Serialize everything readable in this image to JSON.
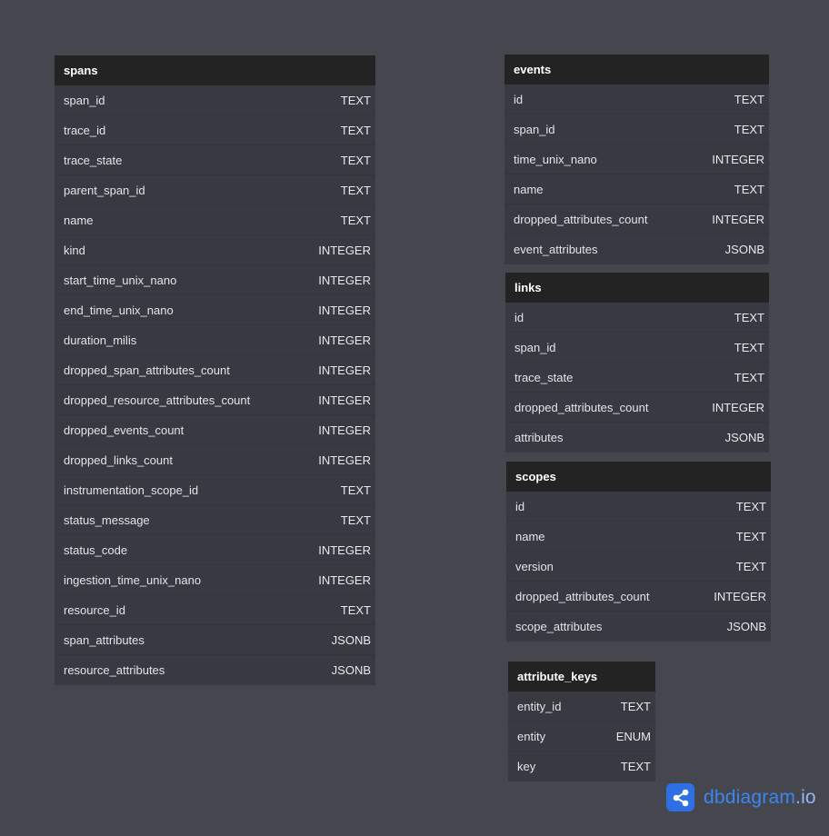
{
  "tables": [
    {
      "id": "spans",
      "name": "spans",
      "columns": [
        {
          "name": "span_id",
          "type": "TEXT"
        },
        {
          "name": "trace_id",
          "type": "TEXT"
        },
        {
          "name": "trace_state",
          "type": "TEXT"
        },
        {
          "name": "parent_span_id",
          "type": "TEXT"
        },
        {
          "name": "name",
          "type": "TEXT"
        },
        {
          "name": "kind",
          "type": "INTEGER"
        },
        {
          "name": "start_time_unix_nano",
          "type": "INTEGER"
        },
        {
          "name": "end_time_unix_nano",
          "type": "INTEGER"
        },
        {
          "name": "duration_milis",
          "type": "INTEGER"
        },
        {
          "name": "dropped_span_attributes_count",
          "type": "INTEGER"
        },
        {
          "name": "dropped_resource_attributes_count",
          "type": "INTEGER"
        },
        {
          "name": "dropped_events_count",
          "type": "INTEGER"
        },
        {
          "name": "dropped_links_count",
          "type": "INTEGER"
        },
        {
          "name": "instrumentation_scope_id",
          "type": "TEXT"
        },
        {
          "name": "status_message",
          "type": "TEXT"
        },
        {
          "name": "status_code",
          "type": "INTEGER"
        },
        {
          "name": "ingestion_time_unix_nano",
          "type": "INTEGER"
        },
        {
          "name": "resource_id",
          "type": "TEXT"
        },
        {
          "name": "span_attributes",
          "type": "JSONB"
        },
        {
          "name": "resource_attributes",
          "type": "JSONB"
        }
      ]
    },
    {
      "id": "events",
      "name": "events",
      "columns": [
        {
          "name": "id",
          "type": "TEXT"
        },
        {
          "name": "span_id",
          "type": "TEXT"
        },
        {
          "name": "time_unix_nano",
          "type": "INTEGER"
        },
        {
          "name": "name",
          "type": "TEXT"
        },
        {
          "name": "dropped_attributes_count",
          "type": "INTEGER"
        },
        {
          "name": "event_attributes",
          "type": "JSONB"
        }
      ]
    },
    {
      "id": "links",
      "name": "links",
      "columns": [
        {
          "name": "id",
          "type": "TEXT"
        },
        {
          "name": "span_id",
          "type": "TEXT"
        },
        {
          "name": "trace_state",
          "type": "TEXT"
        },
        {
          "name": "dropped_attributes_count",
          "type": "INTEGER"
        },
        {
          "name": "attributes",
          "type": "JSONB"
        }
      ]
    },
    {
      "id": "scopes",
      "name": "scopes",
      "columns": [
        {
          "name": "id",
          "type": "TEXT"
        },
        {
          "name": "name",
          "type": "TEXT"
        },
        {
          "name": "version",
          "type": "TEXT"
        },
        {
          "name": "dropped_attributes_count",
          "type": "INTEGER"
        },
        {
          "name": "scope_attributes",
          "type": "JSONB"
        }
      ]
    },
    {
      "id": "attr",
      "name": "attribute_keys",
      "columns": [
        {
          "name": "entity_id",
          "type": "TEXT"
        },
        {
          "name": "entity",
          "type": "ENUM"
        },
        {
          "name": "key",
          "type": "TEXT"
        }
      ]
    }
  ],
  "brand": {
    "name": "dbdiagram",
    "tld": ".io",
    "icon": "share-nodes-icon",
    "color": "#3c86f0"
  }
}
